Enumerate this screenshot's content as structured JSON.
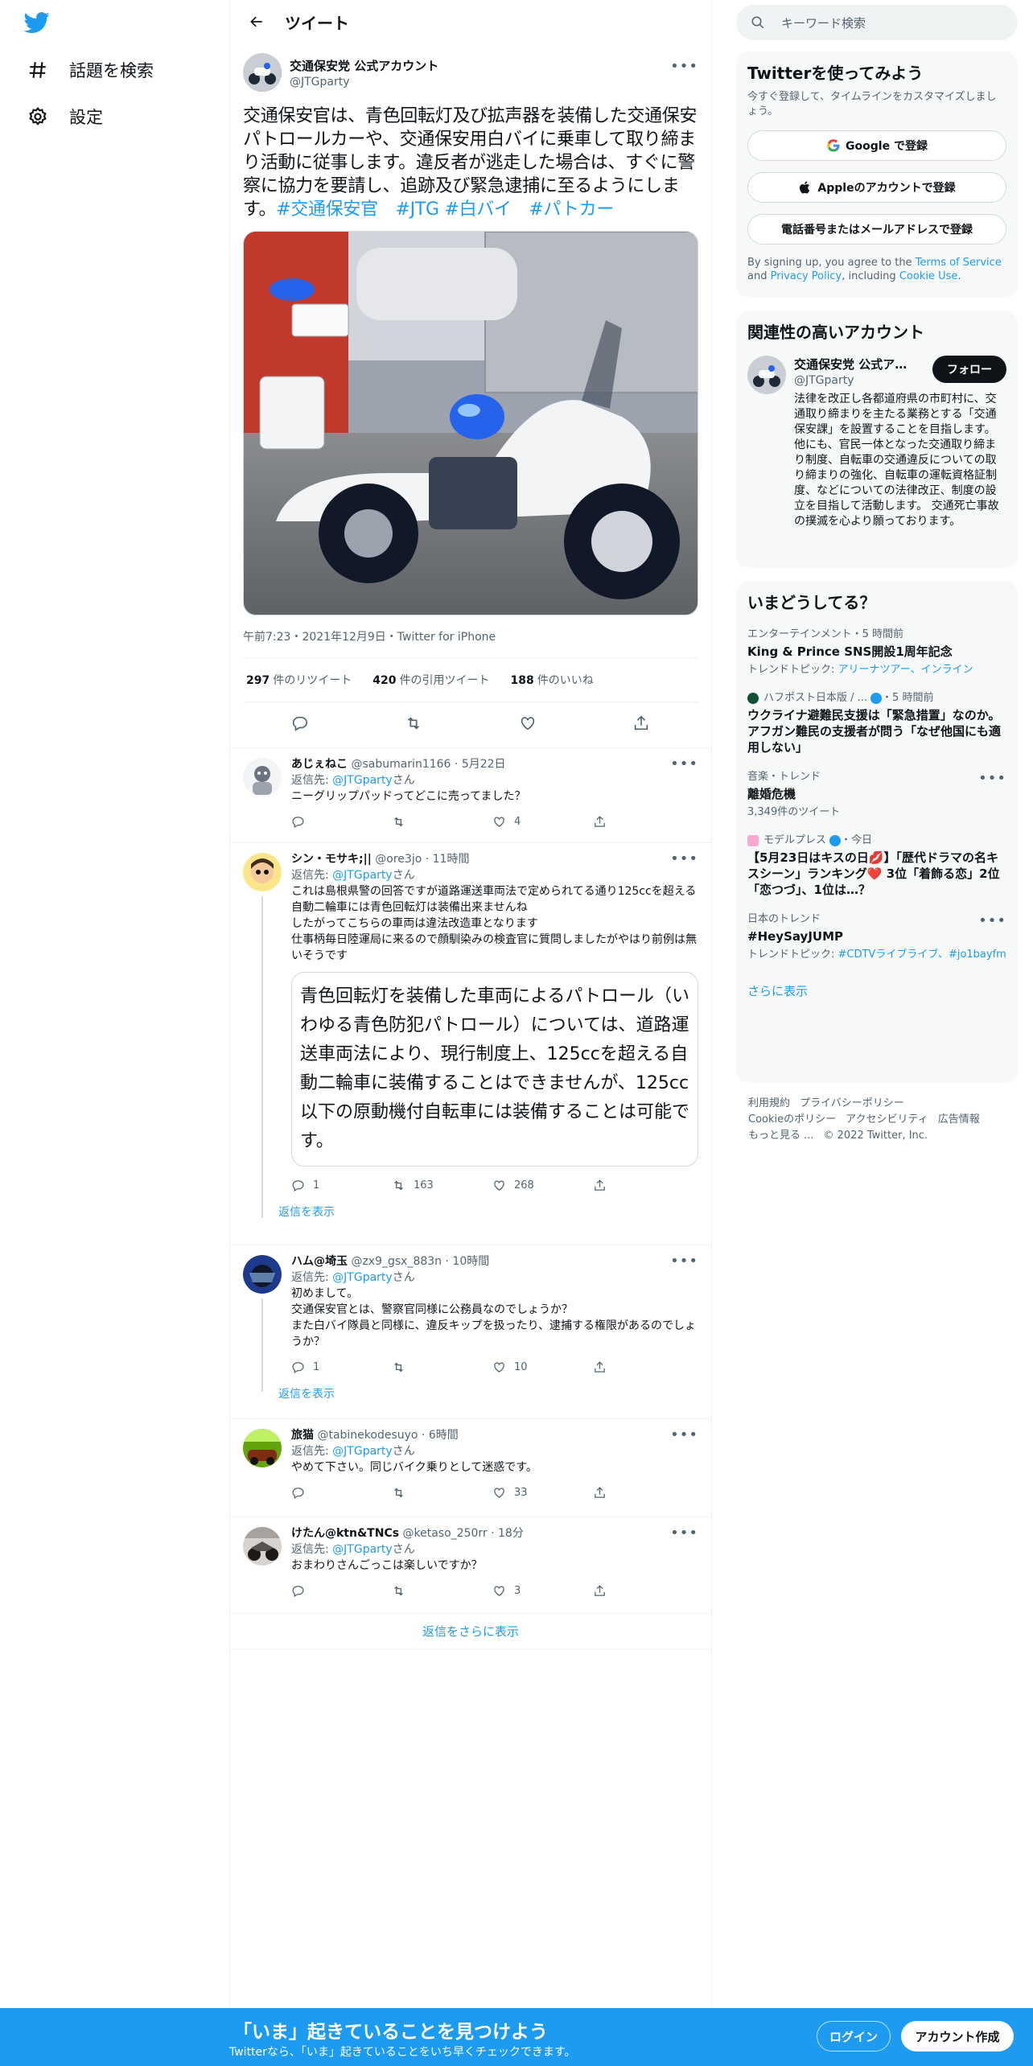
{
  "nav": {
    "logo": "twitter-bird-icon",
    "items": [
      {
        "label": "話題を検索",
        "icon": "hashtag-icon"
      },
      {
        "label": "設定",
        "icon": "gear-icon"
      }
    ]
  },
  "header": {
    "title": "ツイート"
  },
  "main_tweet": {
    "name": "交通保安党 公式アカウント",
    "handle": "@JTGparty",
    "text": "交通保安官は、青色回転灯及び拡声器を装備した交通保安パトロールカーや、交通保安用白バイに乗車して取り締まり活動に従事します。違反者が逃走した場合は、すぐに警察に協力を要請し、追跡及び緊急逮捕に至るようにします。",
    "hashtags": [
      "#交通保安官",
      "#JTG",
      "#白バイ",
      "#パトカー"
    ],
    "meta": "午前7:23・2021年12月9日・Twitter for iPhone",
    "stats": {
      "retweets_count": "297",
      "retweets_label": "件のリツイート",
      "quotes_count": "420",
      "quotes_label": "件の引用ツイート",
      "likes_count": "188",
      "likes_label": "件のいいね"
    }
  },
  "replies": [
    {
      "name": "あじぇねこ",
      "handle": "@sabumarin1166",
      "time": "5月22日",
      "to_prefix": "返信先: ",
      "to_handle": "@JTGparty",
      "to_suffix": "さん",
      "text": "ニーグリップパッドってどこに売ってました？",
      "replies": "",
      "retweets": "",
      "likes": "4"
    },
    {
      "name": "シン・モサキ;||",
      "handle": "@ore3jo",
      "time": "11時間",
      "to_prefix": "返信先: ",
      "to_handle": "@JTGparty",
      "to_suffix": "さん",
      "text": "これは島根県警の回答ですが道路運送車両法で定められてる通り125ccを超える自動二輪車には青色回転灯は装備出来ませんね\nしたがってこちらの車両は違法改造車となります\n仕事柄毎日陸運局に来るので顔馴染みの検査官に質問しましたがやはり前例は無いそうです",
      "quote": "青色回転灯を装備した車両によるパトロール（いわゆる青色防犯パトロール）については、道路運送車両法により、現行制度上、125ccを超える自動二輪車に装備することはできませんが、125cc以下の原動機付自転車には装備することは可能です。",
      "replies": "1",
      "retweets": "163",
      "likes": "268",
      "show_replies": "返信を表示"
    },
    {
      "name": "ハム@埼玉",
      "handle": "@zx9_gsx_883n",
      "time": "10時間",
      "to_prefix": "返信先: ",
      "to_handle": "@JTGparty",
      "to_suffix": "さん",
      "text": "初めまして。\n交通保安官とは、警察官同様に公務員なのでしょうか？\nまた白バイ隊員と同様に、違反キップを扱ったり、逮捕する権限があるのでしょうか？",
      "replies": "1",
      "retweets": "",
      "likes": "10",
      "show_replies": "返信を表示"
    },
    {
      "name": "旅猫",
      "handle": "@tabinekodesuyo",
      "time": "6時間",
      "to_prefix": "返信先: ",
      "to_handle": "@JTGparty",
      "to_suffix": "さん",
      "text": "やめて下さい。同じバイク乗りとして迷惑です。",
      "replies": "",
      "retweets": "",
      "likes": "33"
    },
    {
      "name": "けたん@ktn&TNCs",
      "handle": "@ketaso_250rr",
      "time": "18分",
      "to_prefix": "返信先: ",
      "to_handle": "@JTGparty",
      "to_suffix": "さん",
      "text": "おまわりさんごっこは楽しいですか？",
      "replies": "",
      "retweets": "",
      "likes": "3"
    }
  ],
  "more_replies": "返信をさらに表示",
  "right": {
    "search_placeholder": "キーワード検索",
    "signup": {
      "title": "Twitterを使ってみよう",
      "sub": "今すぐ登録して、タイムラインをカスタマイズしましょう。",
      "google": "Google で登録",
      "apple": "Appleのアカウントで登録",
      "phone": "電話番号またはメールアドレスで登録",
      "fine_1": "By signing up, you agree to the ",
      "terms": "Terms of Service",
      "fine_2": " and ",
      "privacy": "Privacy Policy",
      "fine_3": ", including ",
      "cookie": "Cookie Use",
      "fine_4": "."
    },
    "related": {
      "title": "関連性の高いアカウント",
      "name": "交通保安党 公式アカ...",
      "handle": "@JTGparty",
      "follow": "フォロー",
      "bio": "法律を改正し各都道府県の市町村に、交通取り締まりを主たる業務とする「交通保安課」を設置することを目指します。他にも、官民一体となった交通取り締まり制度、自転車の交通違反についての取り締まりの強化、自転車の運転資格証制度、などについての法律改正、制度の設立を目指して活動します。 交通死亡事故の撲滅を心より願っております。"
    },
    "trends": {
      "title": "いまどうしてる？",
      "items": [
        {
          "context": "エンターテインメント・5 時間前",
          "title": "King & Prince SNS開設1周年記念",
          "topic_label": "トレンドトピック: ",
          "topic": "アリーナツアー、インライン"
        },
        {
          "context": "ハフポスト日本版 / ...",
          "context_time": "・5 時間前",
          "title": "ウクライナ避難民支援は「緊急措置」なのか。アフガン難民の支援者が問う「なぜ他国にも適用しない」"
        },
        {
          "context": "音楽・トレンド",
          "title": "離婚危機",
          "sub": "3,349件のツイート"
        },
        {
          "context": "モデルプレス",
          "context_time": "・今日",
          "title": "【5月23日はキスの日💋】「歴代ドラマの名キスシーン」ランキング❤️ 3位「着飾る恋」2位「恋つづ」、1位は…？"
        },
        {
          "context": "日本のトレンド",
          "title": "#HeySayJUMP",
          "topic_label": "トレンドトピック: ",
          "topic": "#CDTVライブライブ、#jo1bayfm"
        }
      ],
      "show_more": "さらに表示"
    },
    "footer": [
      "利用規約",
      "プライバシーポリシー",
      "Cookieのポリシー",
      "アクセシビリティ",
      "広告情報",
      "もっと見る ...",
      "© 2022 Twitter, Inc."
    ]
  },
  "bottom_bar": {
    "title": "「いま」起きていることを見つけよう",
    "sub": "Twitterなら、「いま」起きていることをいち早くチェックできます。",
    "login": "ログイン",
    "signup": "アカウント作成"
  }
}
